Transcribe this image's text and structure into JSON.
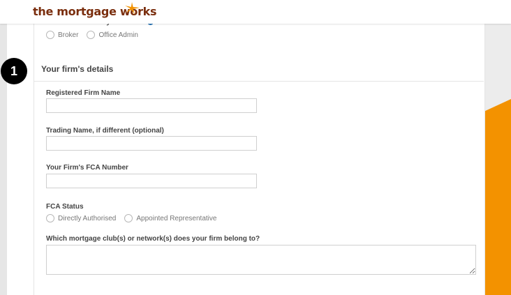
{
  "header": {
    "logo_text": "the mortgage works"
  },
  "access_question": {
    "label": "What access do you need?",
    "options": [
      "Broker",
      "Office Admin"
    ]
  },
  "step_number": "1",
  "section": {
    "title": "Your firm's details"
  },
  "fields": {
    "registered_name": {
      "label": "Registered Firm Name",
      "value": ""
    },
    "trading_name": {
      "label": "Trading Name, if different (optional)",
      "value": ""
    },
    "fca_number": {
      "label": "Your Firm's FCA Number",
      "value": ""
    },
    "fca_status": {
      "label": "FCA Status",
      "options": [
        "Directly Authorised",
        "Appointed Representative"
      ]
    },
    "clubs": {
      "label": "Which mortgage club(s) or network(s) does your firm belong to?",
      "value": ""
    }
  },
  "colors": {
    "accent_orange": "#f39200",
    "logo_brown": "#7a2e0e",
    "info_blue": "#1f6fb3"
  }
}
